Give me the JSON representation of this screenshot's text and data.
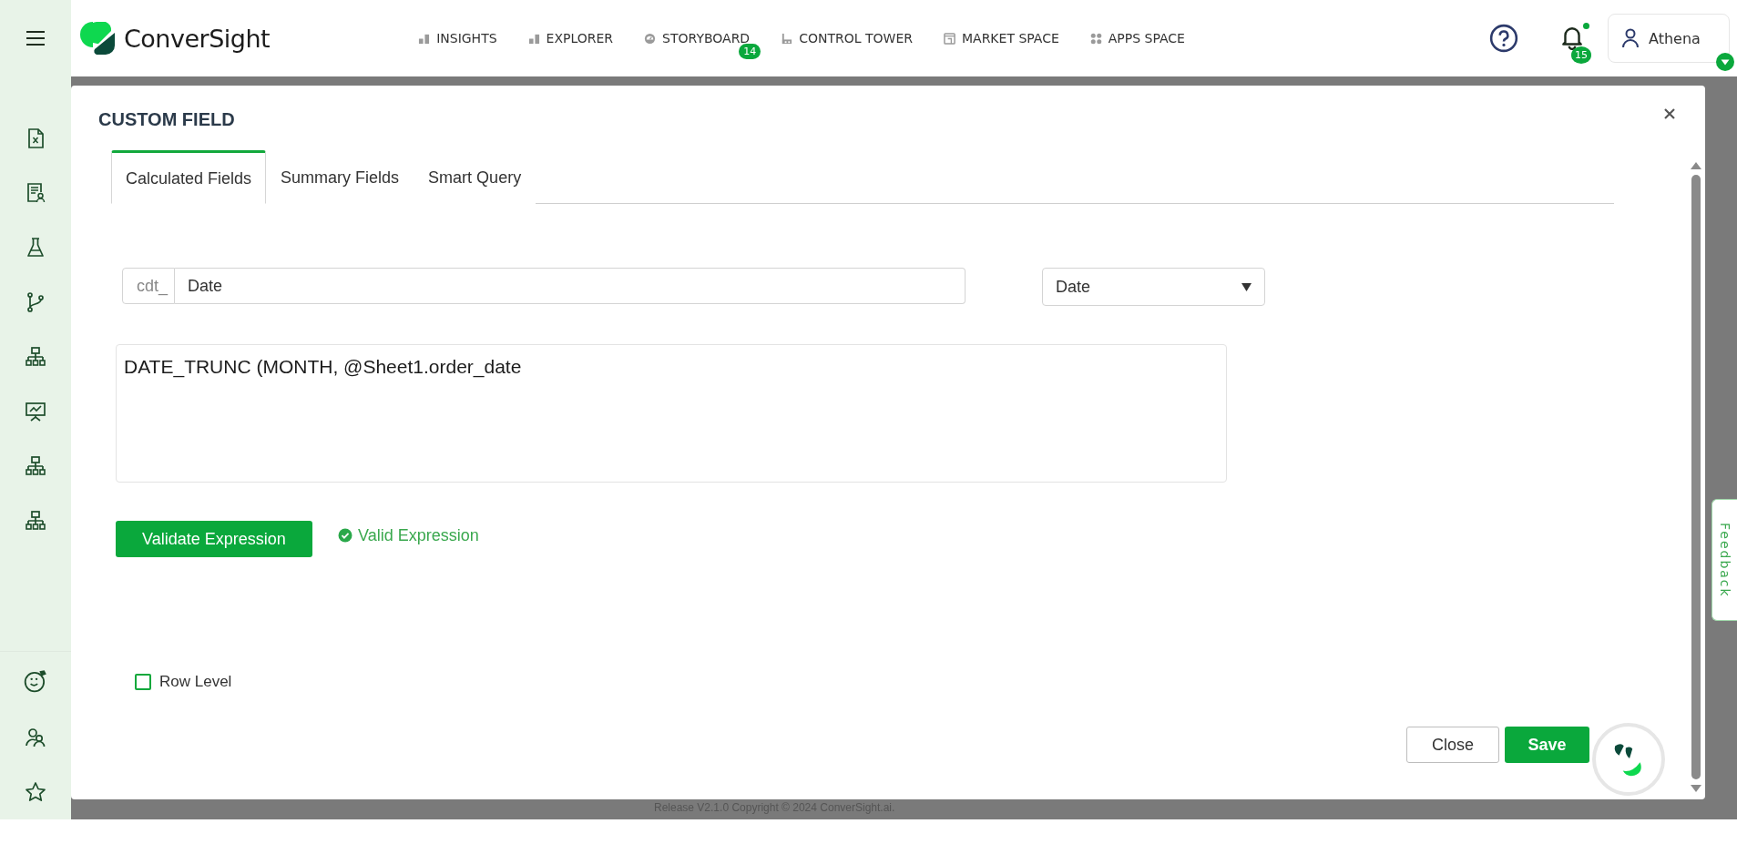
{
  "app": {
    "logo_text": "ConverSight"
  },
  "nav": [
    {
      "label": "INSIGHTS"
    },
    {
      "label": "EXPLORER"
    },
    {
      "label": "STORYBOARD",
      "badge": "14"
    },
    {
      "label": "CONTROL TOWER"
    },
    {
      "label": "MARKET SPACE"
    },
    {
      "label": "APPS SPACE"
    }
  ],
  "notifications": {
    "count": "15",
    "unread": true
  },
  "user": {
    "name": "Athena"
  },
  "dialog": {
    "title": "CUSTOM FIELD",
    "tabs": [
      {
        "label": "Calculated Fields",
        "selected": true
      },
      {
        "label": "Summary Fields",
        "selected": false
      },
      {
        "label": "Smart Query",
        "selected": false
      }
    ],
    "name_field": {
      "prefix": "cdt_",
      "value": "Date"
    },
    "type_select": {
      "value": "Date"
    },
    "expression": "DATE_TRUNC (MONTH, @Sheet1.order_date",
    "validate_button": "Validate Expression",
    "validation": {
      "text": "Valid Expression",
      "valid": true
    },
    "row_level": {
      "label": "Row Level",
      "checked": false
    },
    "close_button": "Close",
    "save_button": "Save"
  },
  "feedback": "Feedback",
  "footer": "Release V2.1.0 Copyright © 2024 ConverSight.ai."
}
